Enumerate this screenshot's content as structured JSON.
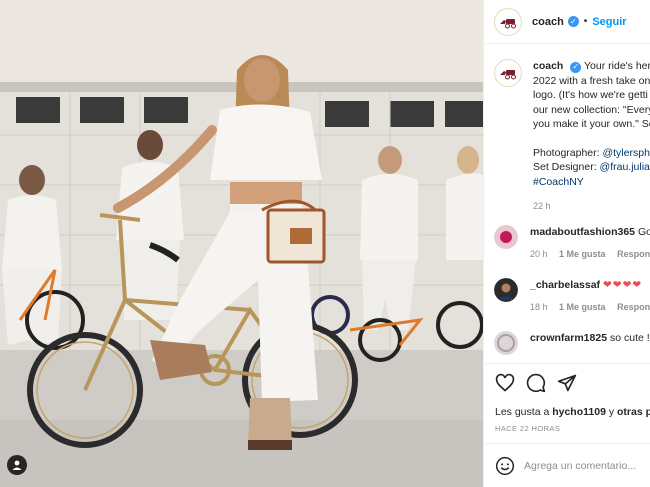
{
  "account": {
    "username": "coach",
    "follow_label": "Seguir",
    "dot": "•",
    "verified_mark": "✓"
  },
  "caption": {
    "username": "coach",
    "lines": [
      "Your ride's here.",
      "2022 with a fresh take on",
      "logo. (It's how we're getti",
      "our new collection: \"Every",
      "you make it your own.\" Se"
    ],
    "photographer_label": "Photographer:",
    "photographer": "@tylerspho",
    "set_designer_label": "Set Designer:",
    "set_designer": "@frau.juliaw",
    "hashtag": "#CoachNY",
    "time": "22 h"
  },
  "comments": [
    {
      "username": "madaboutfashion365",
      "text": "Go",
      "time": "20 h",
      "likes": "1 Me gusta",
      "reply": "Responde"
    },
    {
      "username": "_charbelassaf",
      "text": "❤❤❤❤",
      "time": "18 h",
      "likes": "1 Me gusta",
      "reply": "Responde"
    },
    {
      "username": "crownfarm1825",
      "text": "so cute !"
    }
  ],
  "likes": {
    "prefix": "Les gusta a",
    "user": "hycho1109",
    "connector": "y",
    "others": "otras per"
  },
  "posted_ago": "HACE 22 HORAS",
  "comment_input": {
    "placeholder": "Agrega un comentario..."
  },
  "icons": {
    "avatar": "coach-horse-carriage-logo",
    "tag": "user-tag-icon",
    "like": "heart-icon",
    "comment": "comment-bubble-icon",
    "share": "paper-plane-icon",
    "emoji": "emoji-smile-icon"
  },
  "colors": {
    "accent": "#0095f6",
    "verified": "#3897f0",
    "link": "#00376b",
    "muted": "#8e8e8e",
    "heart": "#ed4956"
  }
}
